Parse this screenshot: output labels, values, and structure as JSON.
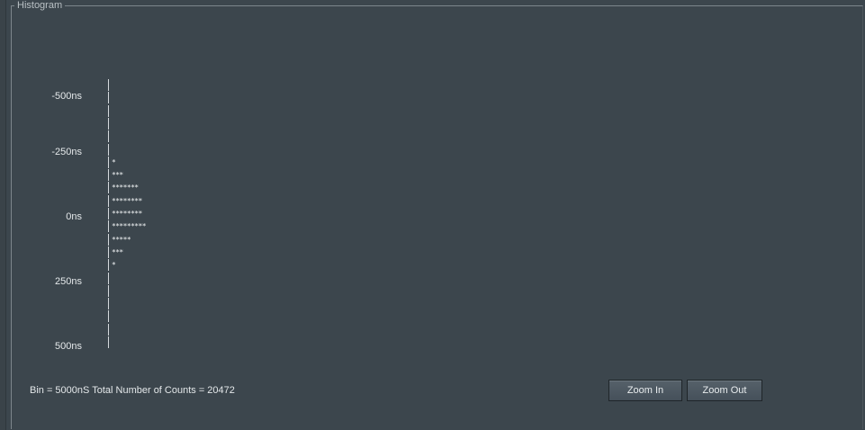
{
  "panel": {
    "title": "Histogram"
  },
  "histogram": {
    "y_labels": [
      "-500ns",
      "-250ns",
      "0ns",
      "250ns",
      "500ns"
    ],
    "rows": [
      "",
      "",
      "",
      "",
      "",
      "",
      "*",
      "***",
      "*******",
      "********",
      "********",
      "*********",
      "*****",
      "***",
      "*",
      "",
      "",
      "",
      "",
      "",
      ""
    ]
  },
  "info": {
    "bin_text": "Bin = 5000nS Total Number of Counts = 20472"
  },
  "buttons": {
    "zoom_in": "Zoom In",
    "zoom_out": "Zoom Out"
  },
  "colors": {
    "background": "#3c464d",
    "text": "#e4e8ea"
  }
}
